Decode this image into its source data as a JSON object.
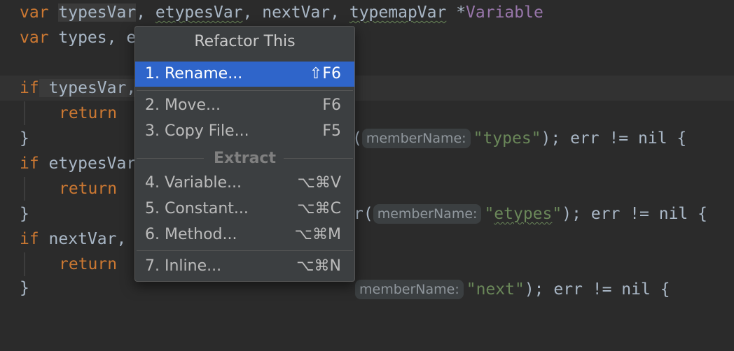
{
  "editor": {
    "line1": {
      "kw": "var",
      "v1": "typesVar",
      "c1": ", ",
      "v2": "etypesVar",
      "c2": ", ",
      "v3": "nextVar",
      "c3": ", ",
      "v4": "typemapVar",
      "ptr": " *",
      "type": "Variable"
    },
    "line2": {
      "kw": "var",
      "rest": " types, e"
    },
    "line4": {
      "kw": "if",
      "var": " typesVar,",
      "paren": "(",
      "hint": "memberName:",
      "str": "\"types\"",
      "tail": "); err != nil {"
    },
    "line5": {
      "kw": "return"
    },
    "line6": {
      "brace": "}"
    },
    "line7": {
      "kw": "if",
      "var": " etypesVar",
      "paren": "r(",
      "hint": "memberName:",
      "str": "\"etypes\"",
      "tail": "); err != nil {"
    },
    "line8": {
      "kw": "return"
    },
    "line9": {
      "brace": "}"
    },
    "line10": {
      "kw": "if",
      "var": " nextVar,",
      "hint": "memberName:",
      "str": "\"next\"",
      "tail": "); err != nil {"
    },
    "line11": {
      "kw": "return"
    },
    "line12": {
      "brace": "}"
    }
  },
  "popup": {
    "title": "Refactor This",
    "items": [
      {
        "label": "1. Rename...",
        "shortcut": "⇧F6",
        "selected": true
      },
      {
        "label": "2. Move...",
        "shortcut": "F6"
      },
      {
        "label": "3. Copy File...",
        "shortcut": "F5"
      },
      {
        "label": "4. Variable...",
        "shortcut": "⌥⌘V"
      },
      {
        "label": "5. Constant...",
        "shortcut": "⌥⌘C"
      },
      {
        "label": "6. Method...",
        "shortcut": "⌥⌘M"
      },
      {
        "label": "7. Inline...",
        "shortcut": "⌥⌘N"
      }
    ],
    "group_header": "Extract"
  },
  "colors": {
    "keyword": "#cc7832",
    "type": "#9876aa",
    "string": "#6a8759",
    "selection": "#2f65ca",
    "background": "#2b2b2b"
  }
}
